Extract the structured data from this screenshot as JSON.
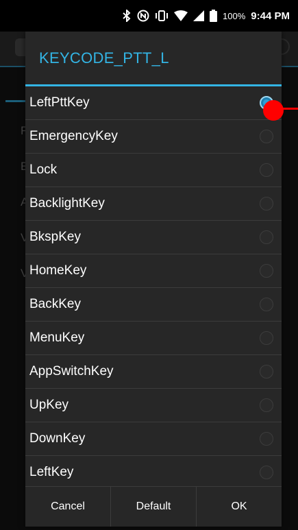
{
  "status_bar": {
    "icons": [
      "bluetooth-icon",
      "nfc-icon",
      "vibrate-icon",
      "wifi-icon",
      "signal-icon",
      "battery-icon"
    ],
    "battery_text": "100%",
    "time": "9:44 PM"
  },
  "dialog": {
    "title": "KEYCODE_PTT_L",
    "accent_color": "#33b5e5",
    "options": [
      {
        "label": "LeftPttKey",
        "selected": true
      },
      {
        "label": "EmergencyKey",
        "selected": false
      },
      {
        "label": "Lock",
        "selected": false
      },
      {
        "label": "BacklightKey",
        "selected": false
      },
      {
        "label": "BkspKey",
        "selected": false
      },
      {
        "label": "HomeKey",
        "selected": false
      },
      {
        "label": "BackKey",
        "selected": false
      },
      {
        "label": "MenuKey",
        "selected": false
      },
      {
        "label": "AppSwitchKey",
        "selected": false
      },
      {
        "label": "UpKey",
        "selected": false
      },
      {
        "label": "DownKey",
        "selected": false
      },
      {
        "label": "LeftKey",
        "selected": false
      }
    ],
    "buttons": {
      "cancel": "Cancel",
      "default": "Default",
      "ok": "OK"
    }
  },
  "background": {
    "partial_letters": [
      "F",
      "E",
      "A",
      "V",
      "V"
    ]
  }
}
